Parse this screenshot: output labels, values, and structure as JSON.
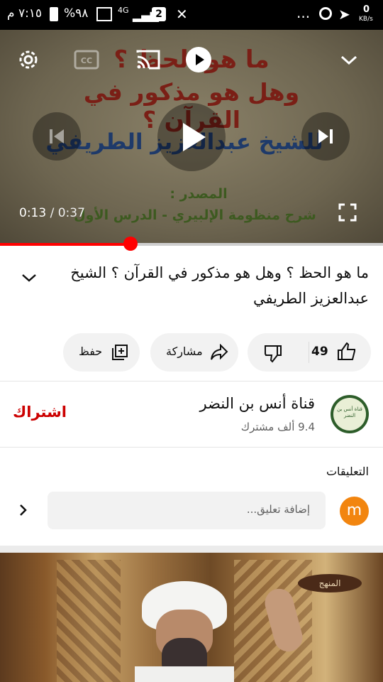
{
  "status_bar": {
    "time": "٧:١٥ م",
    "battery": "%٩٨",
    "network": "4G",
    "sim_badge": "2",
    "net_speed_value": "0",
    "net_speed_unit": "KB/s",
    "more": "..."
  },
  "player": {
    "overlay": {
      "line1": "ما هو الحظ ؟",
      "line2": "وهل هو مذكور في القرآن ؟",
      "line3": "للشيخ عبدالعزيز الطريفي",
      "line4": "المصدر :",
      "line5": "شرح منظومة الإلبيري - الدرس الأول"
    },
    "time_current": "0:13",
    "time_sep": " / ",
    "time_total": "0:37",
    "progress": 0.34
  },
  "video": {
    "title": "ما هو الحظ ؟ وهل هو مذكور في القرآن ؟ الشيخ عبدالعزيز الطريفي"
  },
  "actions": {
    "like_count": "49",
    "share_label": "مشاركة",
    "save_label": "حفظ"
  },
  "channel": {
    "name": "قناة أنس بن النضر",
    "subscribers": "9.4 ألف مشترك",
    "subscribe_label": "اشتراك",
    "avatar_text": "قناة أنس بن النضر"
  },
  "comments": {
    "title": "التعليقات",
    "placeholder": "إضافة تعليق...",
    "user_initial": "m"
  },
  "next_video": {
    "watermark": "المنهج"
  },
  "colors": {
    "accent_red": "#ff0000",
    "subscribe_red": "#cc0000",
    "avatar_orange": "#f2850f"
  }
}
